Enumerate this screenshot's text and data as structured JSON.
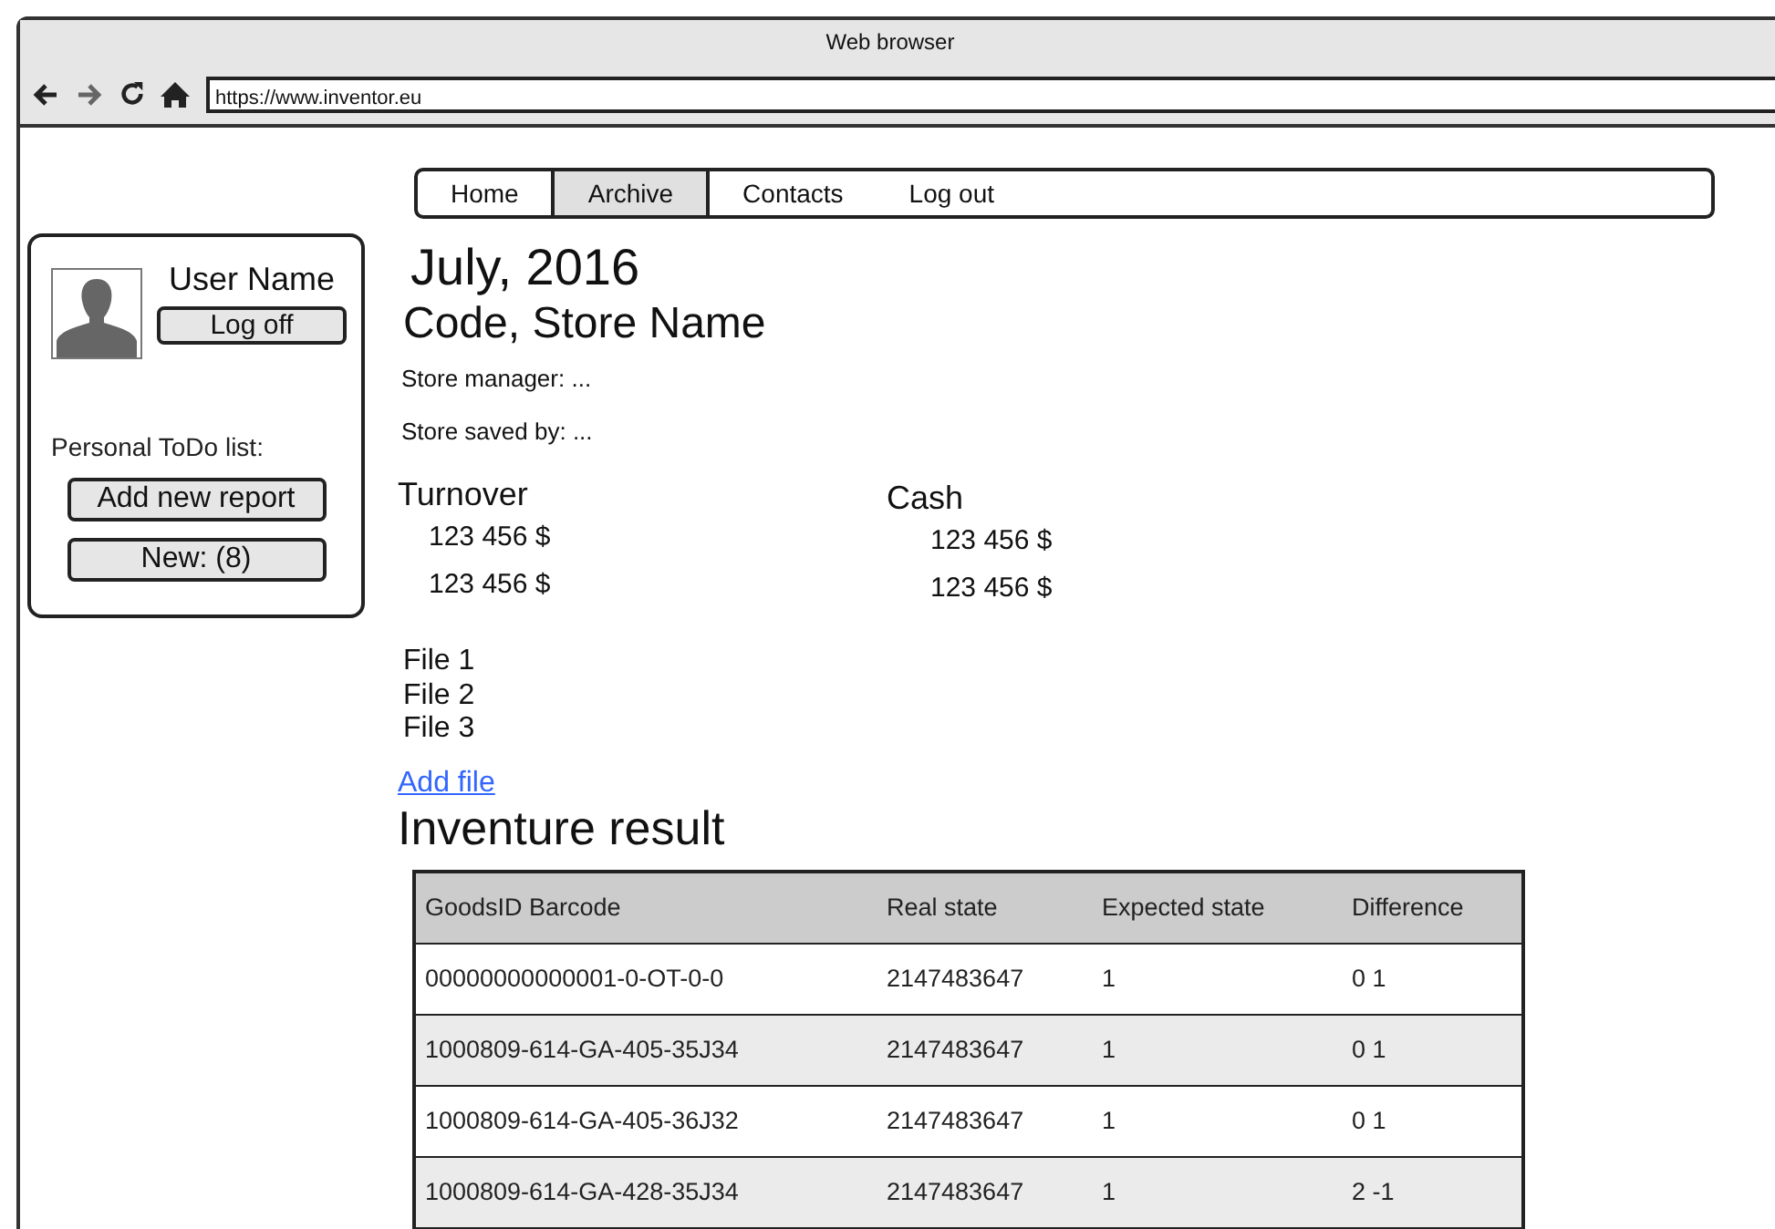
{
  "window": {
    "title": "Web browser"
  },
  "address_bar": {
    "url": "https://www.inventor.eu"
  },
  "nav": [
    {
      "label": "Home",
      "selected": false
    },
    {
      "label": "Archive",
      "selected": true
    },
    {
      "label": "Contacts",
      "selected": false
    },
    {
      "label": "Log out",
      "selected": false
    }
  ],
  "sidebar": {
    "user_name": "User Name",
    "log_off": "Log off",
    "todo_label": "Personal ToDo list:",
    "buttons": [
      "Add new report",
      "New: (8)"
    ]
  },
  "heading": "July, 2016",
  "store": "Code, Store Name",
  "details": [
    "Store manager: ...",
    "Store saved by: ..."
  ],
  "figures": [
    {
      "title": "Turnover",
      "values": [
        "123 456 $",
        "123 456 $"
      ]
    },
    {
      "title": "Cash",
      "values": [
        "123 456 $",
        "123 456 $"
      ]
    }
  ],
  "files": [
    "File 1",
    "File 2",
    "File 3"
  ],
  "add_file": "Add file",
  "result_title": "Inventure result",
  "table": {
    "columns": [
      "GoodsID Barcode",
      "Real state",
      "Expected state",
      "Difference"
    ],
    "rows": [
      [
        "00000000000001-0-OT-0-0",
        "2147483647",
        "1",
        "0 1"
      ],
      [
        "1000809-614-GA-405-35J34",
        "2147483647",
        "1",
        "0 1"
      ],
      [
        "1000809-614-GA-405-36J32",
        "2147483647",
        "1",
        "0 1"
      ],
      [
        "1000809-614-GA-428-35J34",
        "2147483647",
        "1",
        "2 -1"
      ]
    ]
  }
}
